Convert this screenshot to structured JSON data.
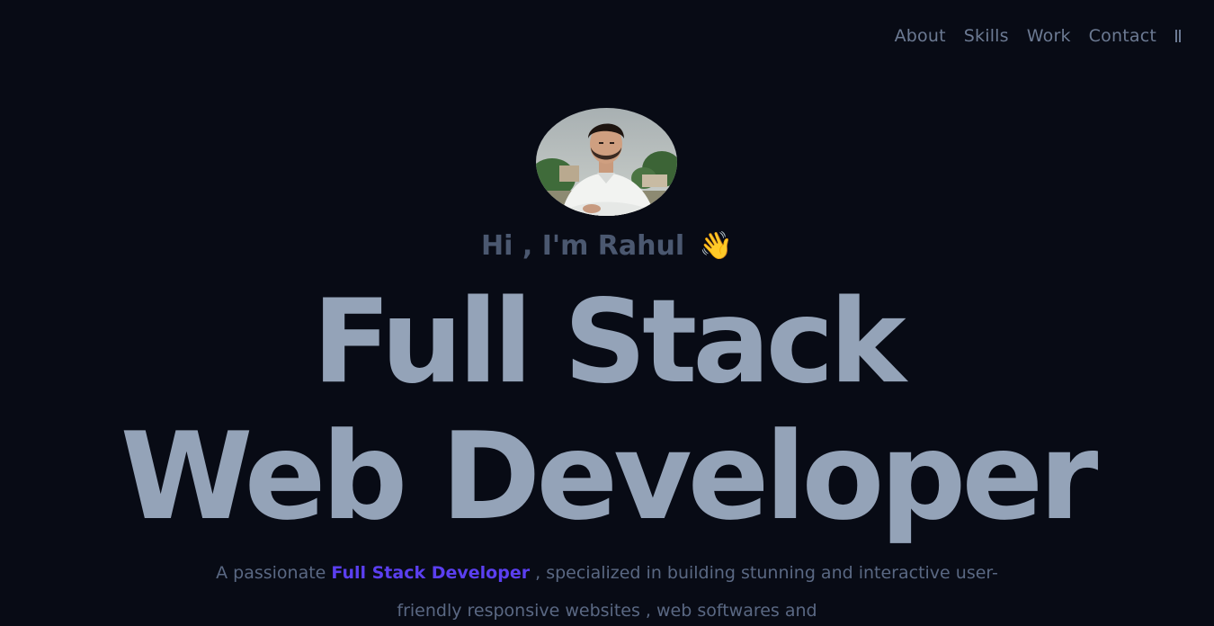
{
  "nav": {
    "items": [
      "About",
      "Skills",
      "Work",
      "Contact"
    ]
  },
  "hero": {
    "greeting": "Hi , I'm Rahul",
    "wave": "👋",
    "headline_line1": "Full Stack",
    "headline_line2": "Web Developer",
    "intro_before": "A passionate ",
    "intro_highlight": "Full Stack Developer",
    "intro_after": " , specialized in building stunning and interactive user-friendly responsive websites , web softwares and"
  },
  "colors": {
    "background": "#080b15",
    "nav_text": "#6c7a93",
    "headline": "#94a3b8",
    "accent": "#5b3ff0"
  },
  "icons": {
    "menu": "menu-toggle-icon",
    "avatar": "profile-photo"
  }
}
